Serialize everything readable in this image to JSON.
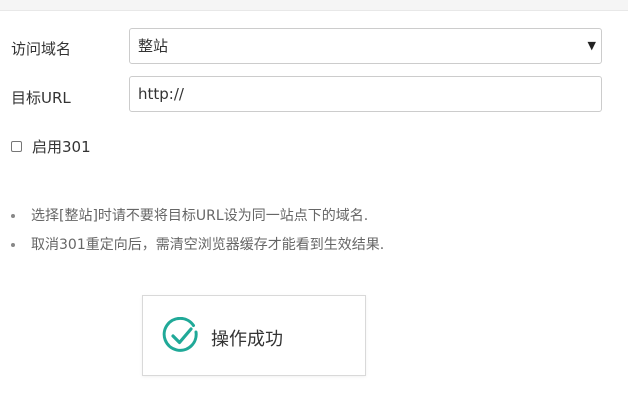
{
  "form": {
    "domain_label": "访问域名",
    "domain_value": "整站",
    "target_label": "目标URL",
    "target_value": "http://",
    "enable_301_label": "启用301",
    "enable_301_checked": false
  },
  "tips": [
    "选择[整站]时请不要将目标URL设为同一站点下的域名.",
    "取消301重定向后，需清空浏览器缓存才能看到生效结果."
  ],
  "toast": {
    "message": "操作成功",
    "icon": "check-circle-icon",
    "icon_color": "#20a998"
  },
  "colors": {
    "accent": "#20a998",
    "border": "#cccccc",
    "text": "#333333",
    "muted": "#666666"
  }
}
